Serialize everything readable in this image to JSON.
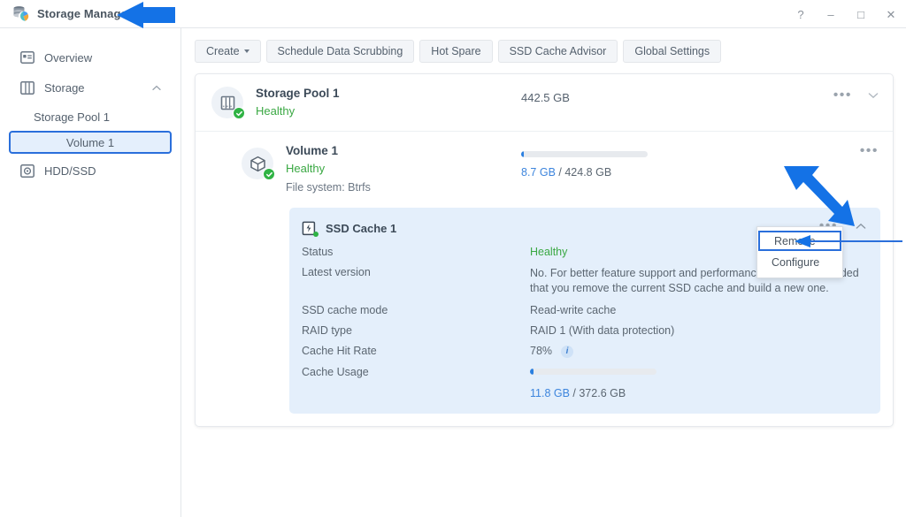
{
  "window": {
    "title": "Storage Manager",
    "app_icon": "storage-manager-icon",
    "controls": [
      {
        "name": "help",
        "glyph": "?"
      },
      {
        "name": "minimize",
        "glyph": "–"
      },
      {
        "name": "maximize",
        "glyph": "□"
      },
      {
        "name": "close",
        "glyph": "✕"
      }
    ]
  },
  "sidebar": {
    "items": [
      {
        "label": "Overview",
        "icon": "overview-icon",
        "type": "item"
      },
      {
        "label": "Storage",
        "icon": "storage-icon",
        "type": "group",
        "expanded": true
      },
      {
        "label": "Storage Pool 1",
        "type": "sub"
      },
      {
        "label": "Volume 1",
        "type": "sub",
        "selected": true
      },
      {
        "label": "HDD/SSD",
        "icon": "hdd-ssd-icon",
        "type": "item"
      }
    ]
  },
  "toolbar": {
    "buttons": [
      {
        "label": "Create",
        "has_caret": true
      },
      {
        "label": "Schedule Data Scrubbing",
        "has_caret": false
      },
      {
        "label": "Hot Spare",
        "has_caret": false
      },
      {
        "label": "SSD Cache Advisor",
        "has_caret": false
      },
      {
        "label": "Global Settings",
        "has_caret": false
      }
    ]
  },
  "storage_pool": {
    "name": "Storage Pool 1",
    "status": "Healthy",
    "size": "442.5 GB",
    "icon": "storage-pool-icon"
  },
  "volume": {
    "name": "Volume 1",
    "status": "Healthy",
    "file_system": "File system: Btrfs",
    "icon": "volume-cube-icon",
    "usage": {
      "used": "8.7 GB",
      "separator": " / ",
      "total": "424.8 GB",
      "percent": 2
    }
  },
  "ssd_cache": {
    "title": "SSD Cache 1",
    "icon": "ssd-cache-icon",
    "rows": [
      {
        "label": "Status",
        "value": "Healthy",
        "style": "green"
      },
      {
        "label": "Latest version",
        "value": "No. For better feature support and performance, it is recommended that you remove the current SSD cache and build a new one.",
        "style": "note"
      },
      {
        "label": "SSD cache mode",
        "value": "Read-write cache",
        "style": "plain"
      },
      {
        "label": "RAID type",
        "value": "RAID 1 (With data protection)",
        "style": "plain"
      },
      {
        "label": "Cache Hit Rate",
        "value": "78%",
        "style": "info"
      }
    ],
    "cache_usage": {
      "label": "Cache Usage",
      "used": "11.8 GB",
      "separator": " / ",
      "total": "372.6 GB",
      "percent": 3
    }
  },
  "context_menu": {
    "items": [
      {
        "label": "Remove",
        "highlighted": true
      },
      {
        "label": "Configure",
        "highlighted": false
      }
    ]
  },
  "annotations": {
    "accent_color": "#1472e6",
    "arrow_title": "arrow-pointing-to-title",
    "arrow_dots": "arrow-pointing-to-ssd-cache-menu-button",
    "arrow_remove": "arrow-pointing-to-remove-menu-item"
  },
  "colors": {
    "accent_blue": "#2a6fdb",
    "annotation_blue": "#1472e6",
    "healthy_green": "#3aa843",
    "panel_blue": "#e4effb",
    "text_gray": "#55616e"
  }
}
